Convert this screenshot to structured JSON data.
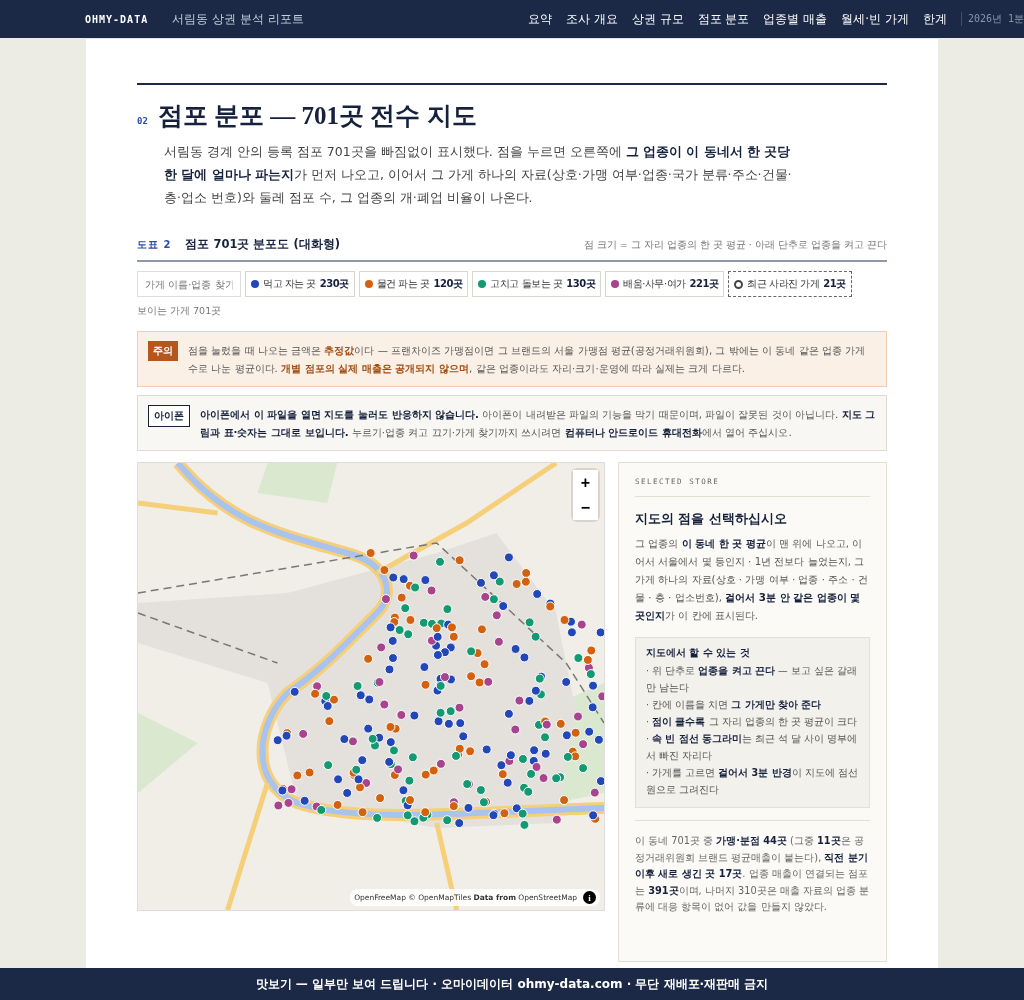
{
  "nav": {
    "logo": "OHMY-DATA",
    "title": "서림동 상권 분석 리포트",
    "items": [
      "요약",
      "조사 개요",
      "상권 규모",
      "점포 분포",
      "업종별 매출",
      "월세·빈 가게",
      "한계"
    ],
    "period": "2026년 1분"
  },
  "section": {
    "number": "02",
    "title": "점포 분포 — 701곳 전수 지도",
    "intro": "서림동 경계 안의 등록 점포 701곳을 빠짐없이 표시했다. 점을 누르면 오른쪽에 **그 업종이 이 동네서 한 곳당 한 달에 얼마나 파는지**가 먼저 나오고, 이어서 그 가게 하나의 자료(상호·가맹 여부·업종·국가 분류·주소·건물·층·업소 번호)와 둘레 점포 수, 그 업종의 개·폐업 비율이 나온다."
  },
  "figure": {
    "label": "도표 2",
    "title": "점포 701곳 분포도 (대화형)",
    "hint": "점 크기 = 그 자리 업종의 한 곳 평균 · 아래 단추로 업종을 켜고 끈다"
  },
  "search": {
    "placeholder": "가게 이름·업종 찾기"
  },
  "filters": [
    {
      "kind": "category",
      "label": "먹고 자는 곳",
      "count": "230곳",
      "color": "#2447b8"
    },
    {
      "kind": "category",
      "label": "물건 파는 곳",
      "count": "120곳",
      "color": "#d2620f"
    },
    {
      "kind": "category",
      "label": "고치고 돌보는 곳",
      "count": "130곳",
      "color": "#139a72"
    },
    {
      "kind": "category",
      "label": "배움·사무·여가",
      "count": "221곳",
      "color": "#a8448e"
    },
    {
      "kind": "closed",
      "label": "최근 사라진 가게",
      "count": "21곳",
      "color": "#444444"
    }
  ],
  "visible_count": "보이는 가게 701곳",
  "notices": [
    {
      "kind": "warning",
      "badge": "주의",
      "text": "점을 눌렀을 때 나오는 금액은 **추정값**이다 — 프랜차이즈 가맹점이면 그 브랜드의 서울 가맹점 평균(공정거래위원회), 그 밖에는 이 동네 같은 업종 가게 수로 나눈 평균이다. **개별 점포의 실제 매출은 공개되지 않으며**, 같은 업종이라도 자리·크기·운영에 따라 실제는 크게 다르다."
    },
    {
      "kind": "info",
      "badge": "아이폰",
      "text": "**아이폰에서 이 파일을 열면 지도를 눌러도 반응하지 않습니다.** 아이폰이 내려받은 파일의 기능을 막기 때문이며, 파일이 잘못된 것이 아닙니다. **지도 그림과 표·숫자는 그대로 보입니다.** 누르기·업종 켜고 끄기·가게 찾기까지 쓰시려면 **컴퓨터나 안드로이드 휴대전화**에서 열어 주십시오."
    }
  ],
  "map": {
    "zoom_in": "+",
    "zoom_out": "−",
    "attribution": "OpenFreeMap © OpenMapTiles **Data from** OpenStreetMap",
    "info": "i"
  },
  "panel": {
    "eyebrow": "SELECTED STORE",
    "heading": "지도의 점을 선택하십시오",
    "body": "그 업종의 **이 동네 한 곳 평균**이 맨 위에 나오고, 이어서 서울에서 몇 등인지 · 1년 전보다 늘었는지, 그 가게 하나의 자료(상호 · 가맹 여부 · 업종 · 주소 · 건물 · 층 · 업소번호), **걸어서 3분 안 같은 업종이 몇 곳인지**가 이 칸에 표시된다.",
    "tips_title": "지도에서 할 수 있는 것",
    "tips": [
      "· 위 단추로 **업종을 켜고 끈다** — 보고 싶은 갈래만 남는다",
      "· 칸에 이름을 치면 **그 가게만 찾아 준다**",
      "· **점이 클수록** 그 자리 업종의 한 곳 평균이 크다",
      "· **속 빈 점선 동그라미**는 최근 석 달 사이 명부에서 빠진 자리다",
      "· 가게를 고르면 **걸어서 3분 반경**이 지도에 점선 원으로 그려진다"
    ],
    "summary": "이 동네 701곳 중 **가맹·분점 44곳** (그중 **11곳**은 공정거래위원회 브랜드 평균매출이 붙는다), **직전 분기 이후 새로 생긴 곳 17곳**. 업종 매출이 연결되는 점포는 **391곳**이며, 나머지 310곳은 매출 자료의 업종 분류에 대응 항목이 없어 값을 만들지 않았다."
  },
  "footer": "맛보기 — 일부만 보여 드립니다 · 오마이데이터 ohmy-data.com · 무단 재배포·재판매 금지"
}
